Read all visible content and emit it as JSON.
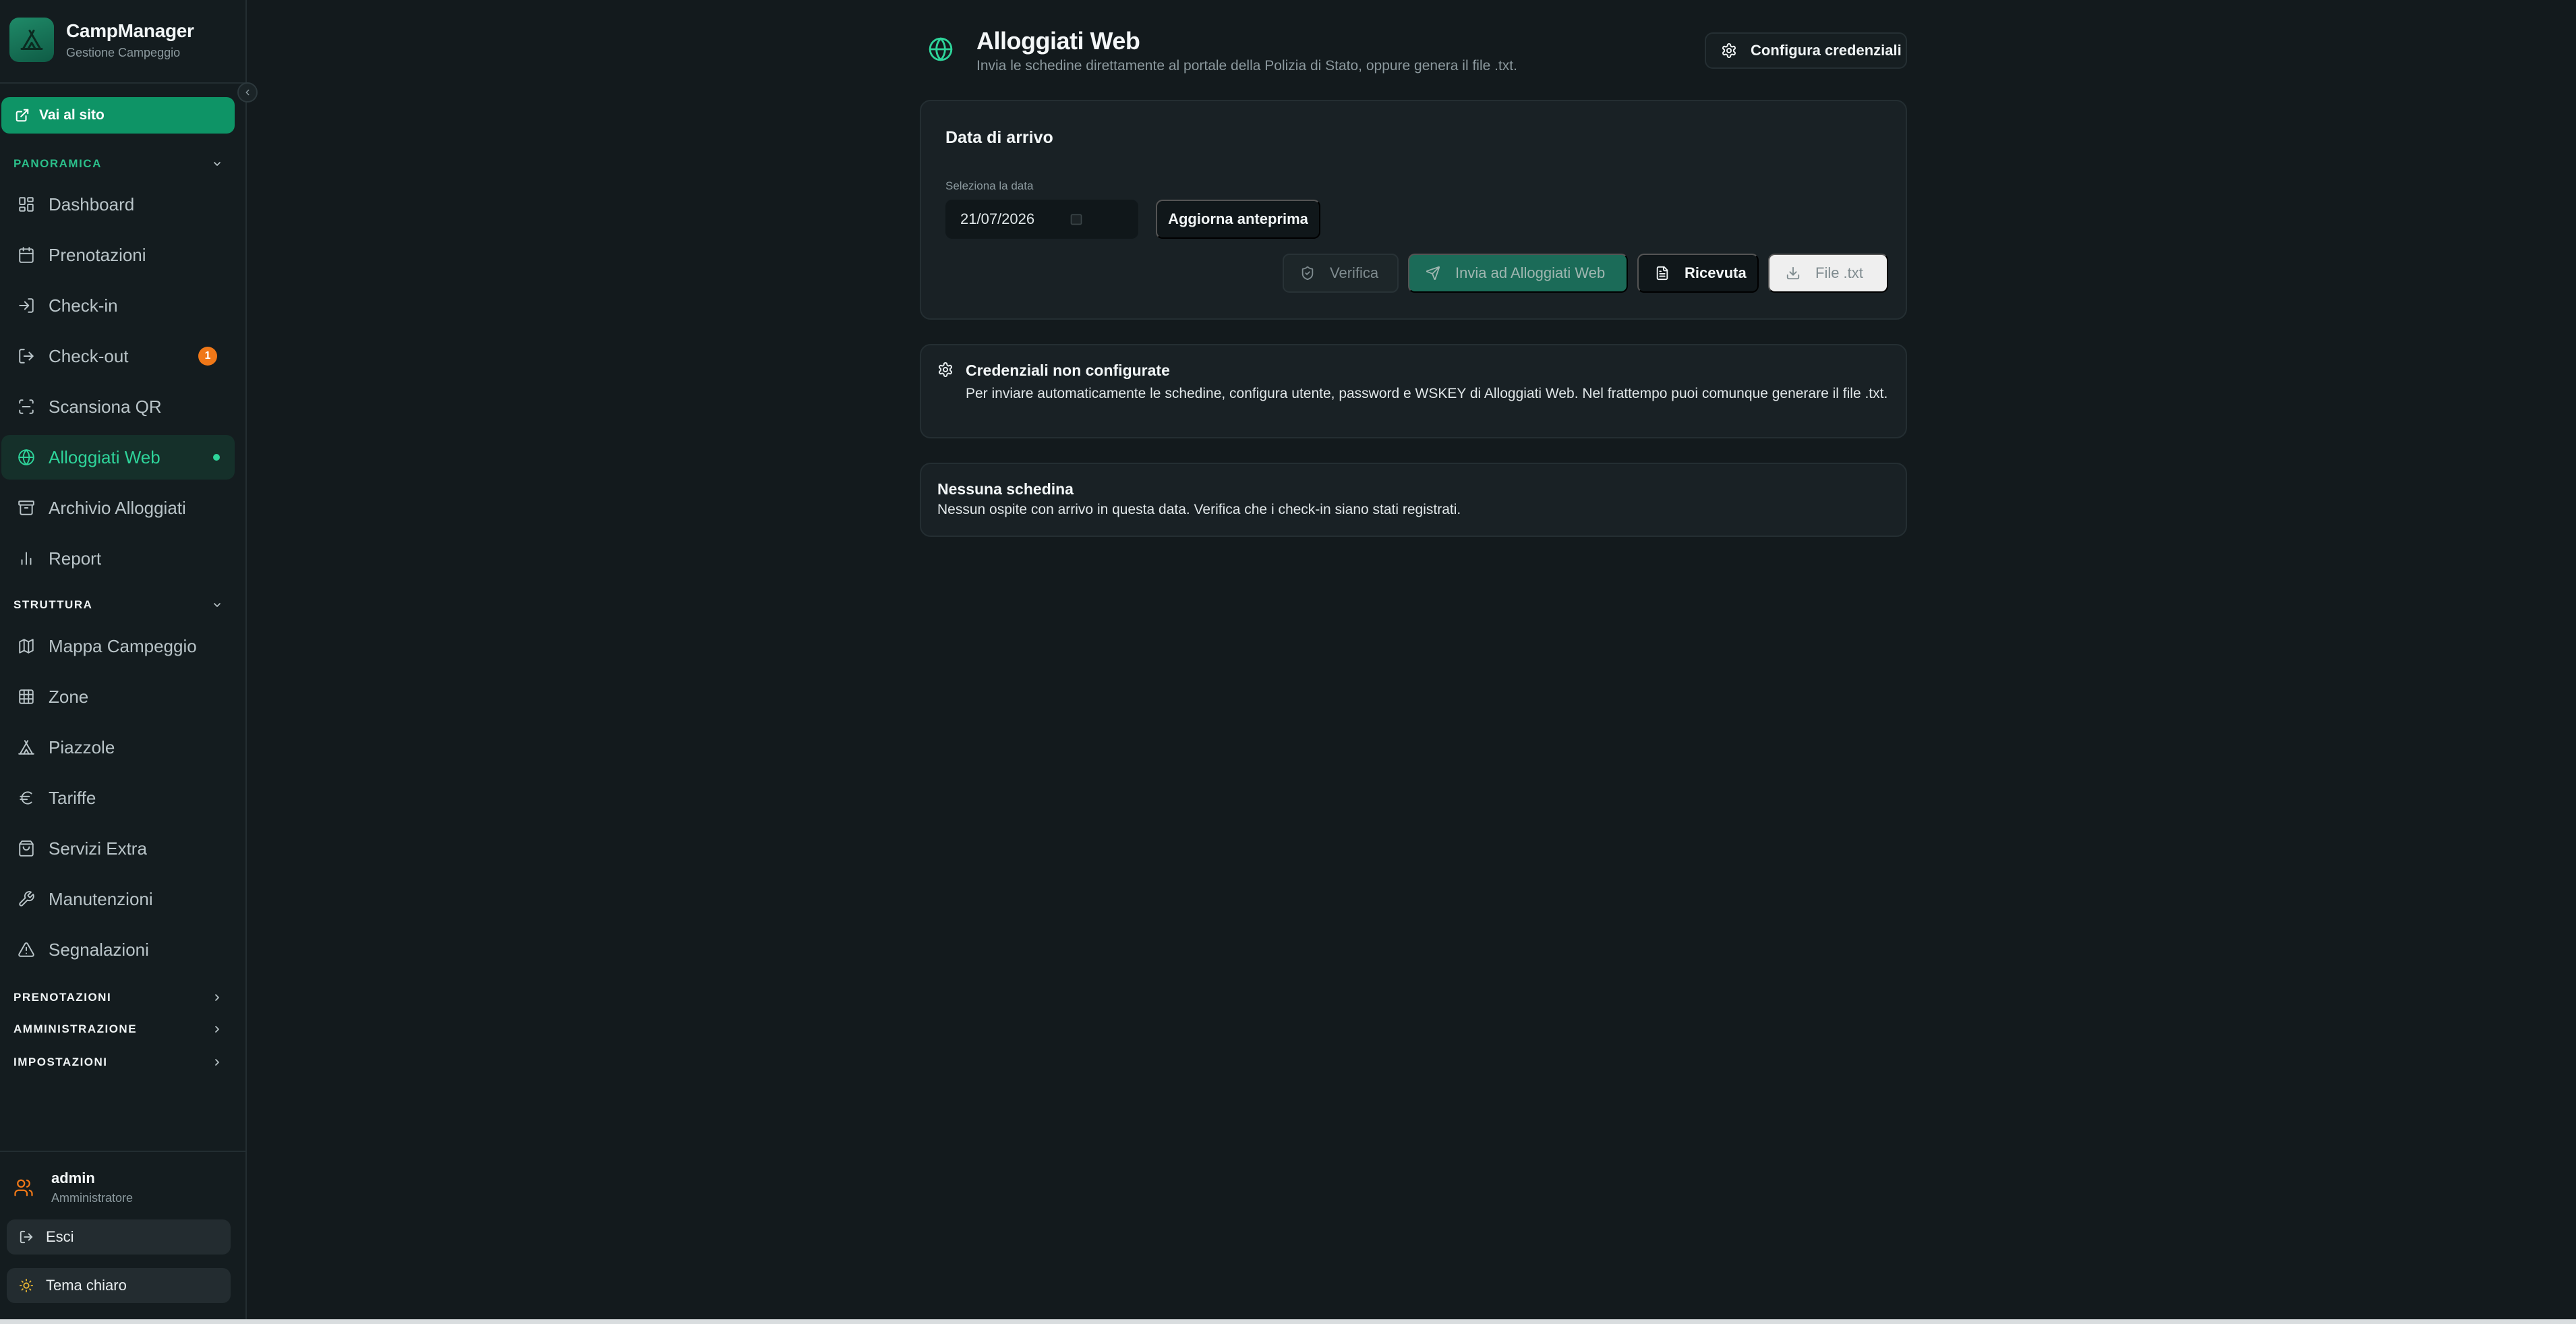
{
  "brand": {
    "name": "CampManager",
    "subtitle": "Gestione Campeggio"
  },
  "sidebar": {
    "visit_site": "Vai al sito",
    "sections": [
      {
        "label": "PANORAMICA",
        "expanded": true
      },
      {
        "label": "STRUTTURA",
        "expanded": true
      },
      {
        "label": "PRENOTAZIONI",
        "expanded": false
      },
      {
        "label": "AMMINISTRAZIONE",
        "expanded": false
      },
      {
        "label": "IMPOSTAZIONI",
        "expanded": false
      }
    ],
    "overview_items": [
      {
        "label": "Dashboard",
        "icon": "dashboard-icon"
      },
      {
        "label": "Prenotazioni",
        "icon": "calendar-icon"
      },
      {
        "label": "Check-in",
        "icon": "login-icon"
      },
      {
        "label": "Check-out",
        "icon": "logout-icon",
        "badge": "1"
      },
      {
        "label": "Scansiona QR",
        "icon": "scan-icon"
      },
      {
        "label": "Alloggiati Web",
        "icon": "globe-icon",
        "active": true
      },
      {
        "label": "Archivio Alloggiati",
        "icon": "archive-icon"
      },
      {
        "label": "Report",
        "icon": "bar-chart-icon"
      }
    ],
    "structure_items": [
      {
        "label": "Mappa Campeggio",
        "icon": "map-icon"
      },
      {
        "label": "Zone",
        "icon": "grid-icon"
      },
      {
        "label": "Piazzole",
        "icon": "tent-icon"
      },
      {
        "label": "Tariffe",
        "icon": "euro-icon"
      },
      {
        "label": "Servizi Extra",
        "icon": "package-icon"
      },
      {
        "label": "Manutenzioni",
        "icon": "wrench-icon"
      },
      {
        "label": "Segnalazioni",
        "icon": "warning-icon"
      }
    ],
    "user": {
      "name": "admin",
      "role": "Amministratore"
    },
    "logout": "Esci",
    "theme_toggle": "Tema chiaro"
  },
  "header": {
    "title": "Alloggiati Web",
    "subtitle": "Invia le schedine direttamente al portale della Polizia di Stato, oppure genera il file .txt.",
    "credentials_button": "Configura credenziali"
  },
  "arrival": {
    "title": "Data di arrivo",
    "date_label": "Seleziona la data",
    "date_value": "21/07/2026",
    "refresh_button": "Aggiorna anteprima",
    "actions": {
      "verify": "Verifica",
      "send": "Invia ad Alloggiati Web",
      "receipt": "Ricevuta",
      "file": "File .txt"
    }
  },
  "credentials_notice": {
    "title": "Credenziali non configurate",
    "text": "Per inviare automaticamente le schedine, configura utente, password e WSKEY di Alloggiati Web. Nel frattempo puoi comunque generare il file .txt."
  },
  "empty_notice": {
    "title": "Nessuna schedina",
    "text": "Nessun ospite con arrivo in questa data. Verifica che i check-in siano stati registrati."
  },
  "colors": {
    "accent": "#0e9466",
    "accent_text": "#2ed49a",
    "badge": "#f07818",
    "background": "#131a1d",
    "sidebar": "#141c1f"
  }
}
